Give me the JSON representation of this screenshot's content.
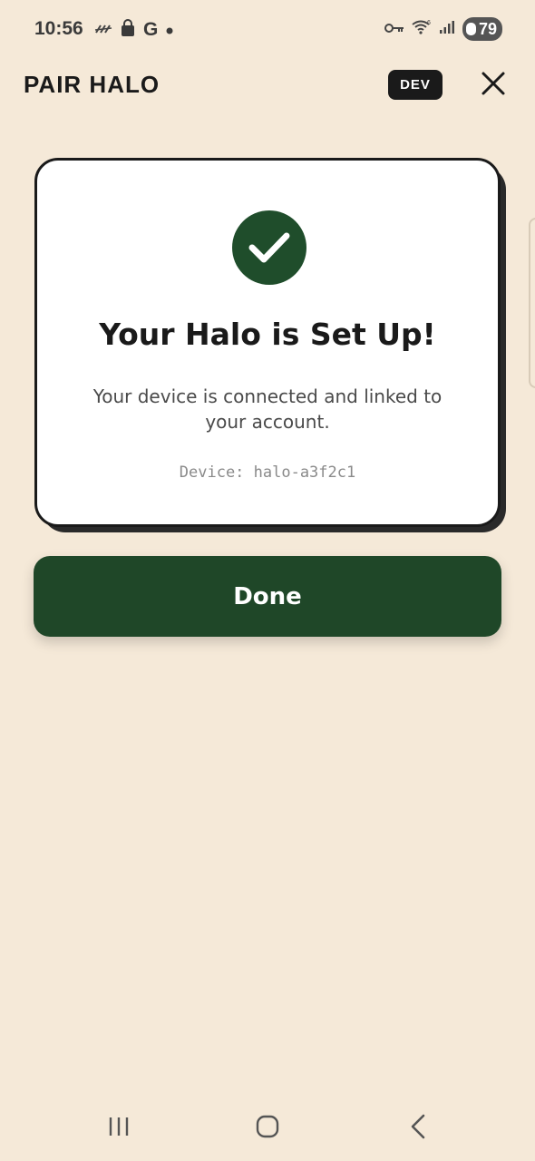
{
  "status_bar": {
    "time": "10:56",
    "battery": "79"
  },
  "header": {
    "title": "PAIR HALO",
    "badge": "DEV"
  },
  "card": {
    "title": "Your Halo is Set Up!",
    "description": "Your device is connected and linked to your account.",
    "device": "Device: halo-a3f2c1"
  },
  "actions": {
    "done_label": "Done"
  },
  "colors": {
    "background": "#f5e9d8",
    "accent_green": "#1f4728",
    "card": "#ffffff"
  },
  "icons": [
    "signal-strike-icon",
    "shopping-bag-icon",
    "google-icon",
    "dot-icon",
    "key-icon",
    "wifi-icon",
    "signal-icon",
    "battery-icon",
    "close-icon",
    "check-circle-icon",
    "recents-icon",
    "home-icon",
    "back-icon"
  ]
}
